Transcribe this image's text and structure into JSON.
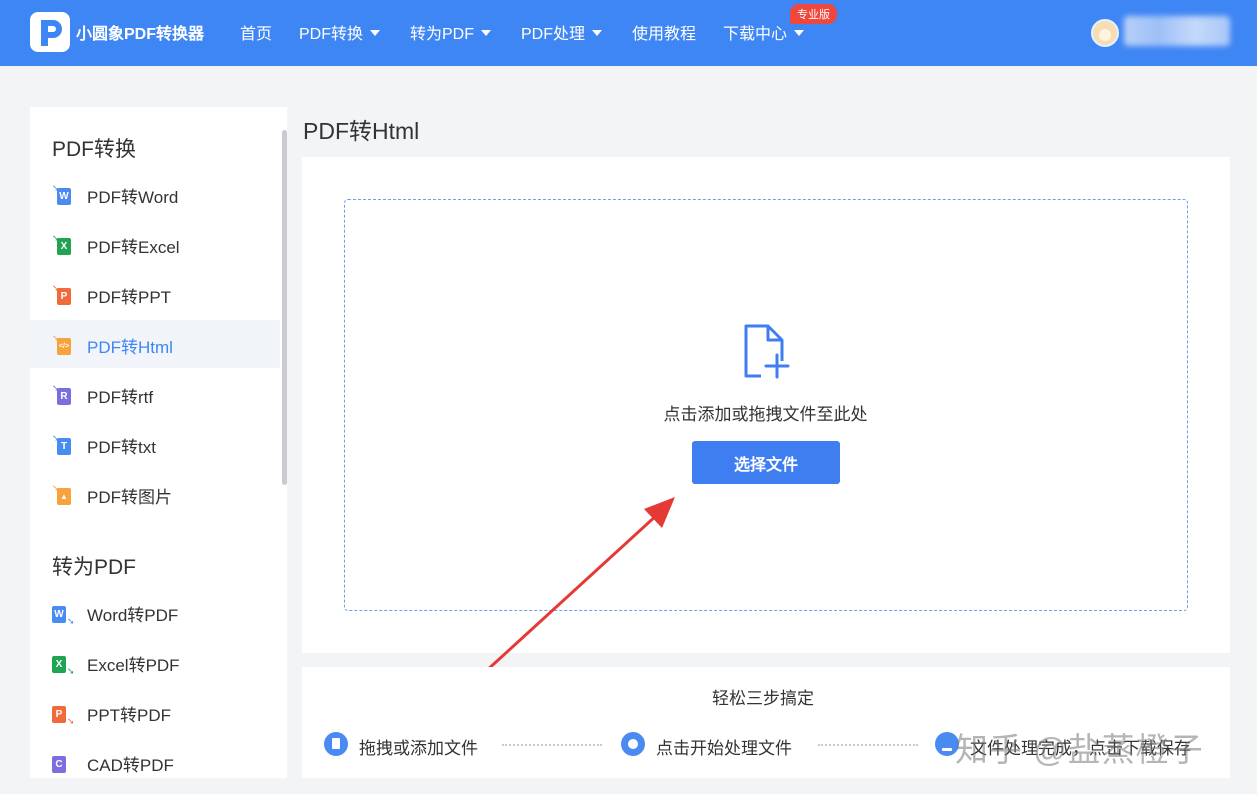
{
  "header": {
    "brand": "小圆象PDF转换器",
    "nav": [
      "首页",
      "PDF转换",
      "转为PDF",
      "PDF处理",
      "使用教程",
      "下载中心"
    ],
    "pro_badge": "专业版",
    "colors": {
      "bar": "#3f86f5",
      "badge": "#f0473c"
    }
  },
  "sidebar": {
    "section1": "PDF转换",
    "items1": [
      {
        "label": "PDF转Word",
        "icon": "word-icon",
        "color": "#4a8bf2",
        "letter": "W"
      },
      {
        "label": "PDF转Excel",
        "icon": "excel-icon",
        "color": "#20a453",
        "letter": "X"
      },
      {
        "label": "PDF转PPT",
        "icon": "ppt-icon",
        "color": "#f06a3b",
        "letter": "P"
      },
      {
        "label": "PDF转Html",
        "icon": "html-icon",
        "color": "#f7a23b",
        "letter": "</>"
      },
      {
        "label": "PDF转rtf",
        "icon": "rtf-icon",
        "color": "#7b6fe0",
        "letter": "R"
      },
      {
        "label": "PDF转txt",
        "icon": "txt-icon",
        "color": "#4a8bf2",
        "letter": "T"
      },
      {
        "label": "PDF转图片",
        "icon": "image-icon",
        "color": "#f7a23b",
        "letter": "▲"
      }
    ],
    "section2": "转为PDF",
    "items2": [
      {
        "label": "Word转PDF",
        "icon": "word-icon",
        "color": "#4a8bf2",
        "letter": "W"
      },
      {
        "label": "Excel转PDF",
        "icon": "excel-icon",
        "color": "#20a453",
        "letter": "X"
      },
      {
        "label": "PPT转PDF",
        "icon": "ppt-icon",
        "color": "#f06a3b",
        "letter": "P"
      },
      {
        "label": "CAD转PDF",
        "icon": "cad-icon",
        "color": "#7b6fe0",
        "letter": "C"
      }
    ],
    "active": "PDF转Html"
  },
  "main": {
    "title": "PDF转Html",
    "drop_hint": "点击添加或拖拽文件至此处",
    "select_button": "选择文件"
  },
  "steps": {
    "title": "轻松三步搞定",
    "items": [
      "拖拽或添加文件",
      "点击开始处理文件",
      "文件处理完成，点击下载保存"
    ]
  },
  "watermark": "知乎 @盐蒸橙子"
}
